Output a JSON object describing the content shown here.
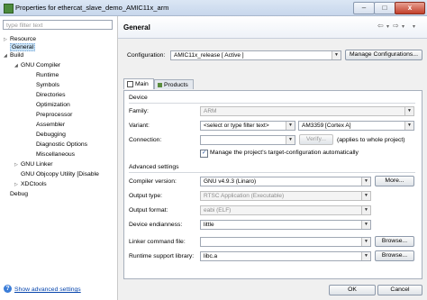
{
  "window": {
    "title": "Properties for ethercat_slave_demo_AMIC11x_arm",
    "minimize": "–",
    "maximize": "□",
    "close": "x"
  },
  "left": {
    "filter_placeholder": "type filter text",
    "tree": [
      {
        "label": "Resource",
        "arrow": "▷"
      },
      {
        "label": "General",
        "arrow": ""
      },
      {
        "label": "Build",
        "arrow": "◢"
      },
      {
        "label": "GNU Compiler",
        "arrow": "◢"
      },
      {
        "label": "Runtime",
        "arrow": ""
      },
      {
        "label": "Symbols",
        "arrow": ""
      },
      {
        "label": "Directories",
        "arrow": ""
      },
      {
        "label": "Optimization",
        "arrow": ""
      },
      {
        "label": "Preprocessor",
        "arrow": ""
      },
      {
        "label": "Assembler",
        "arrow": ""
      },
      {
        "label": "Debugging",
        "arrow": ""
      },
      {
        "label": "Diagnostic Options",
        "arrow": ""
      },
      {
        "label": "Miscellaneous",
        "arrow": ""
      },
      {
        "label": "GNU Linker",
        "arrow": "▷"
      },
      {
        "label": "GNU Objcopy Utility  [Disable",
        "arrow": ""
      },
      {
        "label": "XDCtools",
        "arrow": "▷"
      },
      {
        "label": "Debug",
        "arrow": ""
      }
    ],
    "show_advanced": "Show advanced settings",
    "help": "?"
  },
  "main": {
    "title": "General",
    "nav_back": "⇦",
    "nav_back_menu": "▾",
    "nav_fwd": "⇨",
    "nav_fwd_menu": "▾",
    "nav_menu": "▾",
    "configuration_label": "Configuration:",
    "configuration_value": "AMIC11x_release  [ Active ]",
    "manage_button": "Manage Configurations...",
    "tabs": [
      {
        "label": "Main"
      },
      {
        "label": "Products"
      }
    ],
    "device": {
      "section": "Device",
      "family_label": "Family:",
      "family_value": "ARM",
      "variant_label": "Variant:",
      "variant_filter": "<select or type filter text>",
      "variant_value": "AM3359 [Cortex A]",
      "connection_label": "Connection:",
      "verify_button": "Verify...",
      "connection_note": "(applies to whole project)",
      "manage_target_label": "Manage the project's target-configuration automatically",
      "manage_target_checked": true
    },
    "advanced": {
      "section": "Advanced settings",
      "compiler_label": "Compiler version:",
      "compiler_value": "GNU v4.9.3 (Linaro)",
      "more_button": "More...",
      "output_type_label": "Output type:",
      "output_type_value": "RTSC Application (Executable)",
      "output_format_label": "Output format:",
      "output_format_value": "eabi (ELF)",
      "endianness_label": "Device endianness:",
      "endianness_value": "little",
      "linker_cmd_label": "Linker command file:",
      "linker_cmd_value": "",
      "browse1": "Browse...",
      "runtime_lib_label": "Runtime support library:",
      "runtime_lib_value": "libc.a",
      "browse2": "Browse..."
    },
    "ok": "OK",
    "cancel": "Cancel"
  }
}
